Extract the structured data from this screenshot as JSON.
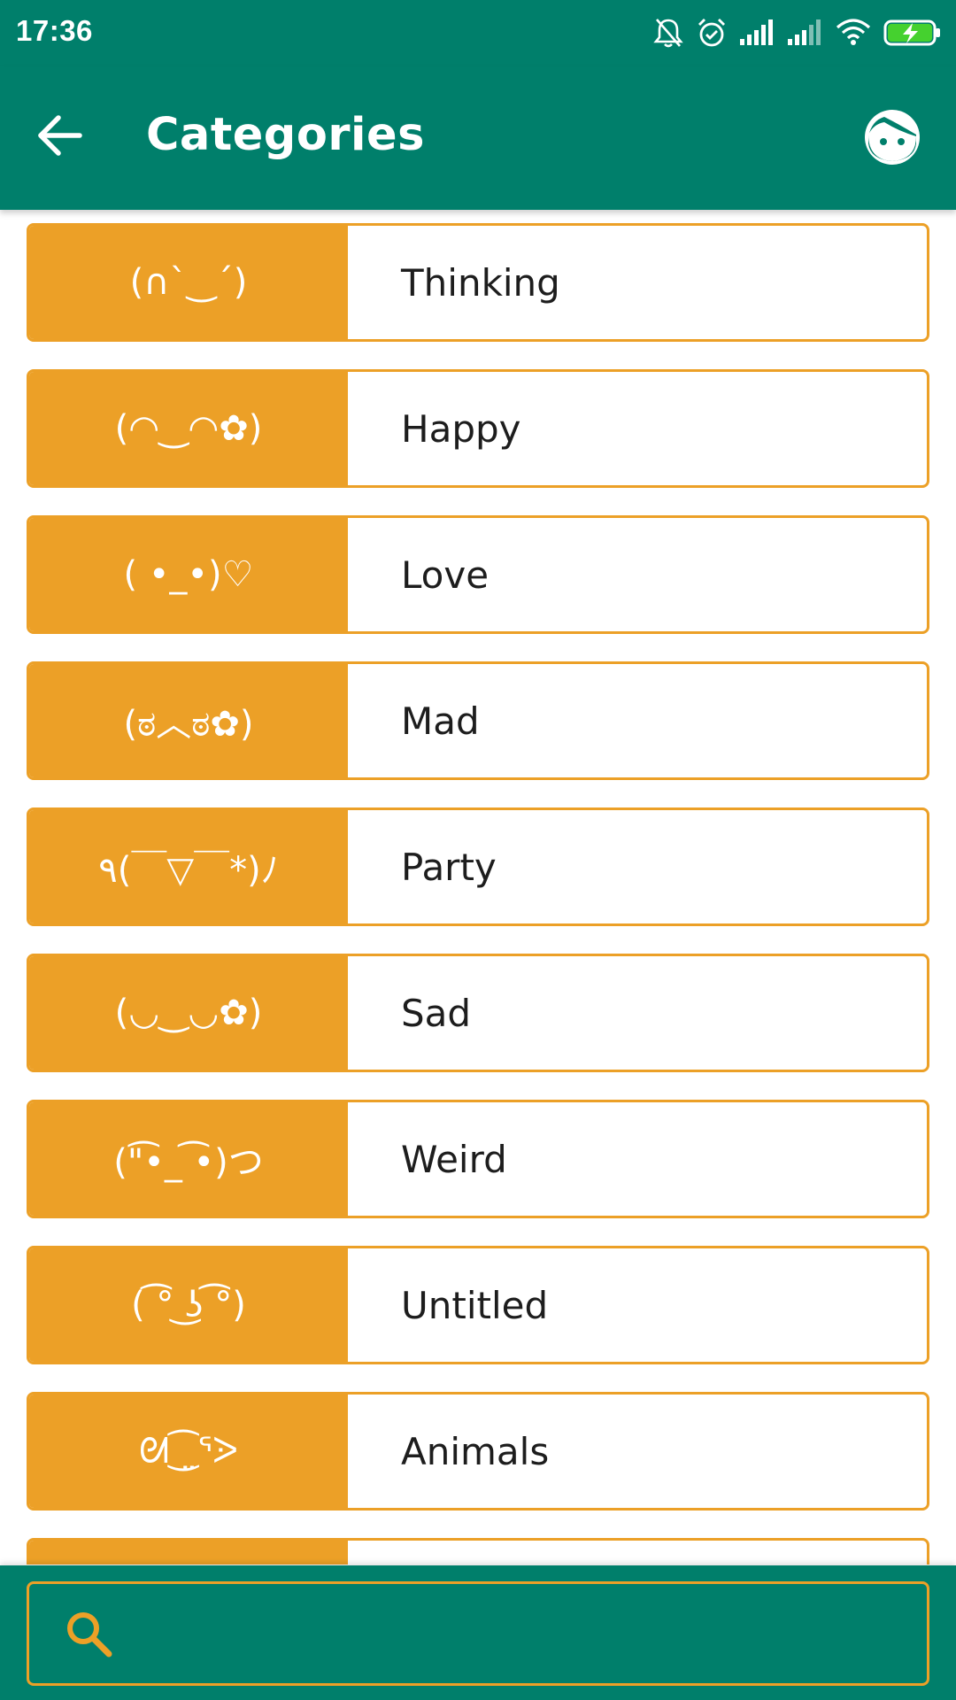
{
  "status_bar": {
    "time": "17:36",
    "icons": [
      "bell-muted-icon",
      "alarm-icon",
      "signal-icon",
      "signal-icon",
      "wifi-icon",
      "battery-charging-icon"
    ]
  },
  "app_bar": {
    "title": "Categories",
    "back_icon": "arrow-left-icon",
    "action_icon": "face-icon"
  },
  "categories": [
    {
      "kaomoji": "(∩`‿´)",
      "label": "Thinking"
    },
    {
      "kaomoji": "(◠‿◠✿)",
      "label": "Happy"
    },
    {
      "kaomoji": "( •_•)♡",
      "label": "Love"
    },
    {
      "kaomoji": "(ಠ︿ಠ✿)",
      "label": "Mad"
    },
    {
      "kaomoji": "٩(￣▽￣*)ﾉ",
      "label": "Party"
    },
    {
      "kaomoji": "(◡‿◡✿)",
      "label": "Sad"
    },
    {
      "kaomoji": "(\"͡•_ ͡•)つ",
      "label": "Weird"
    },
    {
      "kaomoji": "( ͡° ͜ʖ ͡°)",
      "label": "Untitled"
    },
    {
      "kaomoji": "ᘛ⁐̤ᕐᐷ",
      "label": "Animals"
    },
    {
      "kaomoji": "",
      "label": ""
    }
  ],
  "search": {
    "placeholder": "",
    "value": ""
  },
  "colors": {
    "primary": "#007f6b",
    "accent": "#eca027",
    "label_text": "#1d1d1d"
  }
}
